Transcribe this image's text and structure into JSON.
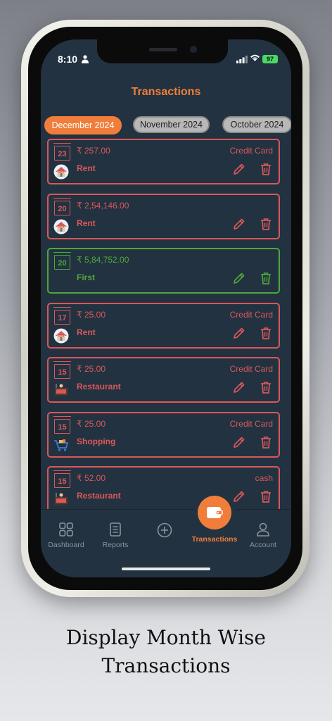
{
  "status_bar": {
    "time": "8:10",
    "battery": "97"
  },
  "header": {
    "title": "Transactions"
  },
  "month_tabs": [
    {
      "label": "December 2024",
      "active": true
    },
    {
      "label": "November 2024",
      "active": false
    },
    {
      "label": "October 2024",
      "active": false
    }
  ],
  "transactions": [
    {
      "day": "23",
      "amount": "₹ 257.00",
      "category": "Rent",
      "method": "Credit Card",
      "icon": "rent-house-icon",
      "color": "#d9585b"
    },
    {
      "day": "20",
      "amount": "₹ 2,54,146.00",
      "category": "Rent",
      "method": "",
      "icon": "rent-house-icon",
      "color": "#d9585b"
    },
    {
      "day": "20",
      "amount": "₹ 5,84,752.00",
      "category": "First",
      "method": "",
      "icon": "none",
      "color": "#4fa63a"
    },
    {
      "day": "17",
      "amount": "₹ 25.00",
      "category": "Rent",
      "method": "Credit Card",
      "icon": "rent-house-icon",
      "color": "#d9585b"
    },
    {
      "day": "15",
      "amount": "₹ 25.00",
      "category": "Restaurant",
      "method": "Credit Card",
      "icon": "restaurant-icon",
      "color": "#d9585b"
    },
    {
      "day": "15",
      "amount": "₹ 25.00",
      "category": "Shopping",
      "method": "Credit Card",
      "icon": "shopping-cart-icon",
      "color": "#d9585b"
    },
    {
      "day": "15",
      "amount": "₹ 52.00",
      "category": "Restaurant",
      "method": "cash",
      "icon": "restaurant-icon",
      "color": "#d9585b"
    }
  ],
  "bottom_nav": {
    "dashboard": "Dashboard",
    "reports": "Reports",
    "transactions": "Transactions",
    "account": "Account"
  },
  "caption": {
    "line1": "Display Month Wise",
    "line2": "Transactions"
  },
  "colors": {
    "accent": "#f07e3a",
    "expense": "#d9585b",
    "income": "#4fa63a",
    "background": "#223240"
  }
}
